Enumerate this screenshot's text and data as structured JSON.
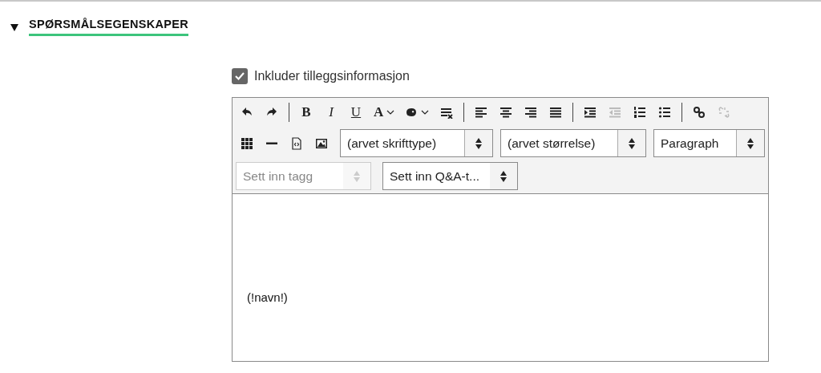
{
  "section": {
    "title": "SPØRSMÅLSEGENSKAPER",
    "expanded": true
  },
  "option": {
    "label": "Inkluder tilleggsinformasjon",
    "checked": true
  },
  "toolbar": {
    "formatting": [
      {
        "kind": "undo",
        "disabled": false
      },
      {
        "kind": "redo",
        "disabled": false
      },
      {
        "kind": "separator"
      },
      {
        "kind": "bold",
        "label": "B",
        "disabled": false
      },
      {
        "kind": "italic",
        "label": "I",
        "disabled": false
      },
      {
        "kind": "underline",
        "label": "U",
        "disabled": false
      },
      {
        "kind": "text-color",
        "label": "A",
        "disabled": false
      },
      {
        "kind": "background-color",
        "disabled": false
      },
      {
        "kind": "clear-format",
        "disabled": false
      },
      {
        "kind": "separator"
      },
      {
        "kind": "align-left",
        "disabled": false
      },
      {
        "kind": "align-center",
        "disabled": false
      },
      {
        "kind": "align-right",
        "disabled": false
      },
      {
        "kind": "justify",
        "disabled": false
      },
      {
        "kind": "separator"
      },
      {
        "kind": "indent",
        "disabled": false
      },
      {
        "kind": "outdent",
        "disabled": true
      },
      {
        "kind": "ordered-list",
        "disabled": false
      },
      {
        "kind": "bullet-list",
        "disabled": false
      },
      {
        "kind": "separator"
      },
      {
        "kind": "link",
        "disabled": false
      },
      {
        "kind": "unlink",
        "disabled": true
      }
    ],
    "inserts": [
      {
        "kind": "table",
        "disabled": false
      },
      {
        "kind": "rule",
        "disabled": false
      },
      {
        "kind": "source",
        "disabled": false
      },
      {
        "kind": "image",
        "disabled": false
      },
      {
        "kind": "select",
        "value": "(arvet skrifttype)",
        "disabled": false
      },
      {
        "kind": "select",
        "value": "(arvet størrelse)",
        "disabled": false
      },
      {
        "kind": "select",
        "value": "Paragraph",
        "disabled": false
      }
    ],
    "tags": [
      {
        "kind": "select",
        "value": "Sett inn tagg",
        "disabled": true
      },
      {
        "kind": "select",
        "value": "Sett inn Q&A-t...",
        "disabled": false
      }
    ]
  },
  "content": {
    "text": "(!navn!)"
  }
}
